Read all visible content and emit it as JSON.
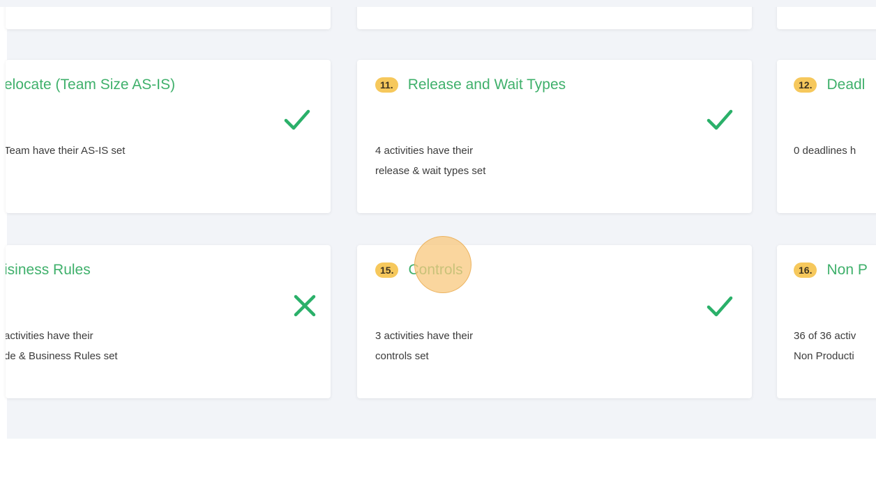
{
  "cards": {
    "top_row": [
      {
        "name": "top-card-1"
      },
      {
        "name": "top-card-2"
      },
      {
        "name": "top-card-3"
      }
    ],
    "relocate": {
      "title": "elocate (Team Size AS-IS)",
      "line1": "Team have their AS-IS set",
      "line2": "",
      "status": "check"
    },
    "release_wait": {
      "number": "11.",
      "title": "Release and Wait Types",
      "line1": "4 activities have their",
      "line2": "release & wait types set",
      "status": "check"
    },
    "deadlines": {
      "number": "12.",
      "title": "Deadl",
      "line1": "0 deadlines h",
      "line2": ""
    },
    "business_rules": {
      "title": "isiness Rules",
      "line1": "activities have their",
      "line2": "de & Business Rules set",
      "status": "cross"
    },
    "controls": {
      "number": "15.",
      "title": "Controls",
      "line1": "3 activities have their",
      "line2": "controls set",
      "status": "check"
    },
    "non_productive": {
      "number": "16.",
      "title": "Non P",
      "line1": "36 of 36 activ",
      "line2": "Non Producti"
    }
  },
  "colors": {
    "accent_green": "#3fb06b",
    "badge_yellow": "#f6c85c",
    "status_green": "#2ab069"
  }
}
